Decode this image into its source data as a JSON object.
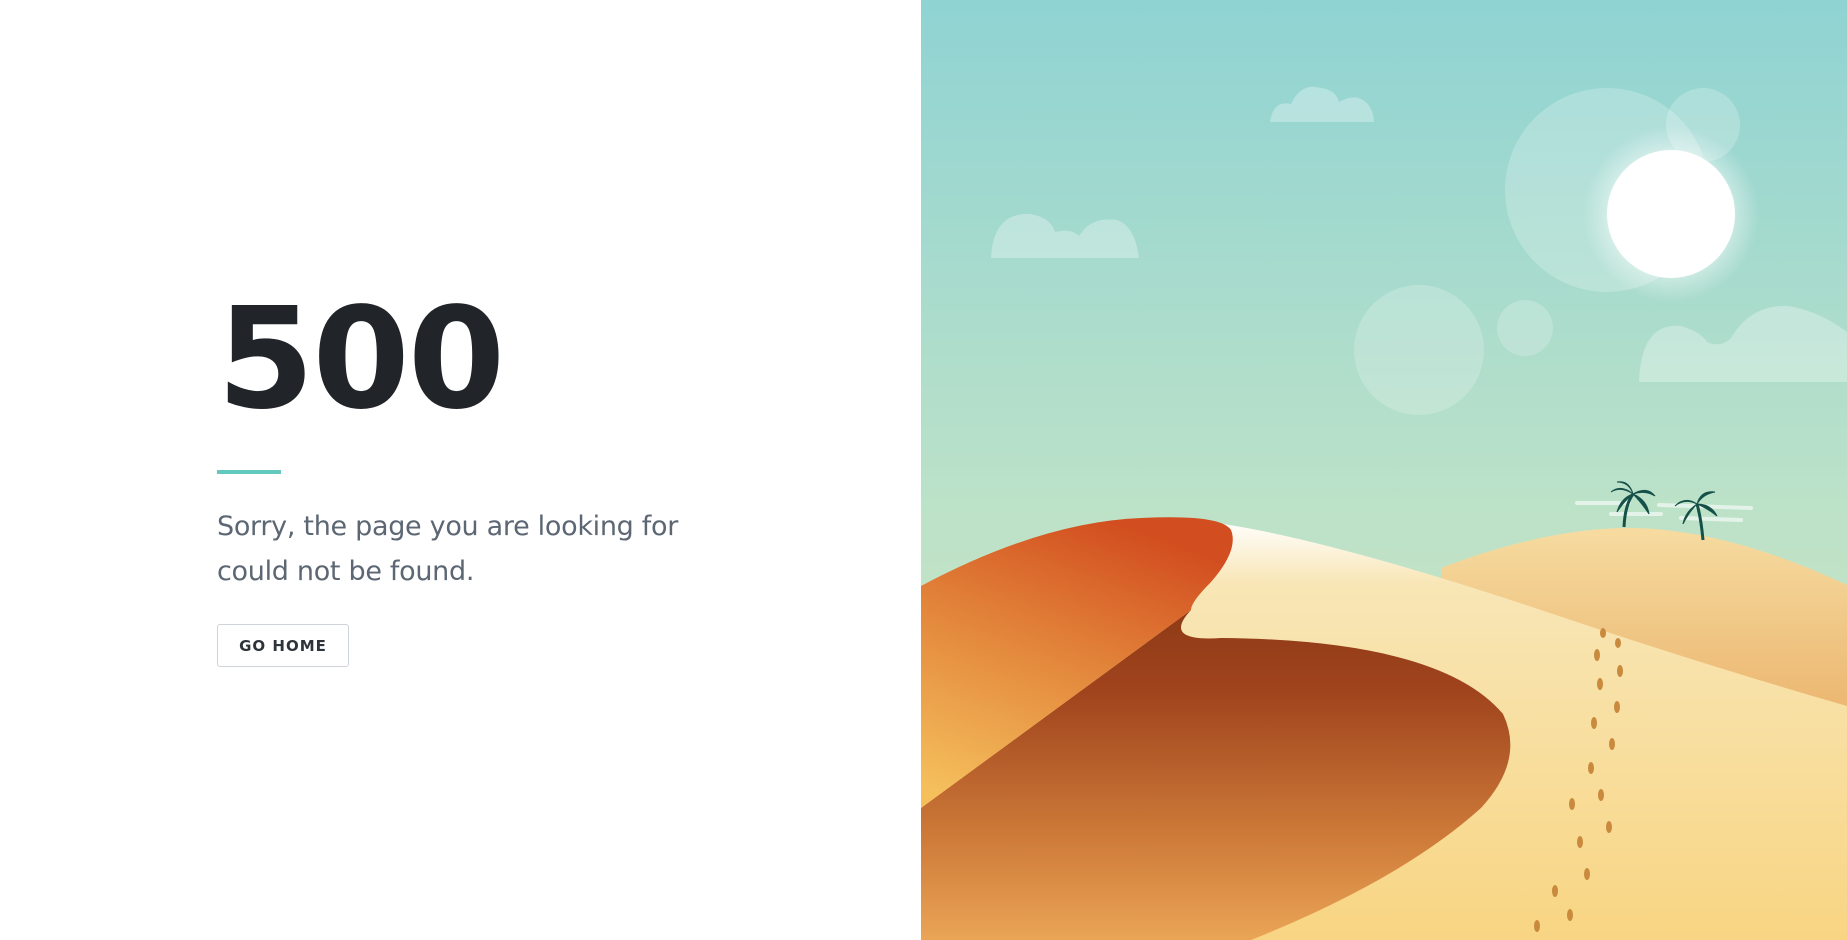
{
  "error": {
    "code": "500",
    "message": "Sorry, the page you are looking for could not be found.",
    "button_label": "GO HOME"
  },
  "colors": {
    "accent": "#63c9bd",
    "heading": "#212529",
    "text": "#5c6773",
    "sky_top": "#8fd3d3",
    "sky_bottom": "#cde3bf",
    "dune_dark": "#a0441d",
    "dune_light": "#f7d892"
  }
}
